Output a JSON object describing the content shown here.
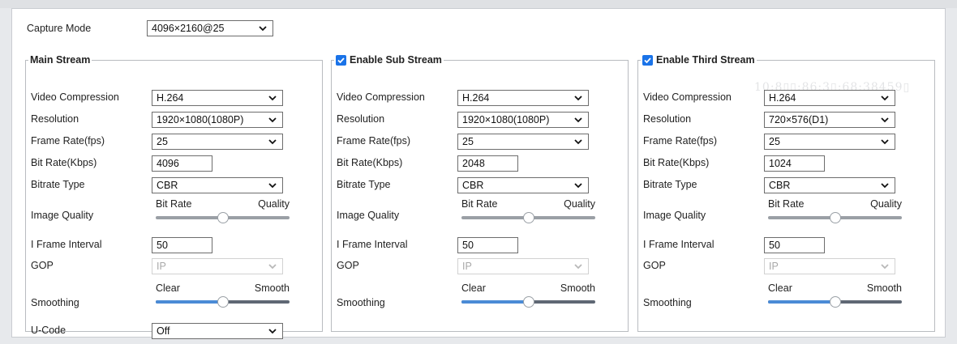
{
  "capture": {
    "label": "Capture Mode",
    "value": "4096×2160@25"
  },
  "watermark": "10:8▯▯:86:3▯:68:38459▯",
  "streams": [
    {
      "title": "Main Stream",
      "checkbox": false,
      "labels": {
        "compression": "Video Compression",
        "resolution": "Resolution",
        "framerate": "Frame Rate(fps)",
        "bitrate": "Bit Rate(Kbps)",
        "bitrate_type": "Bitrate Type",
        "image_quality": "Image Quality",
        "iframe": "I Frame Interval",
        "gop": "GOP",
        "smoothing": "Smoothing",
        "ucode": "U-Code"
      },
      "compression": "H.264",
      "resolution": "1920×1080(1080P)",
      "framerate": "25",
      "bitrate": "4096",
      "bitrate_type": "CBR",
      "quality_left": "Bit Rate",
      "quality_right": "Quality",
      "quality_level": 0.5,
      "iframe": "50",
      "gop": "IP",
      "smooth_left": "Clear",
      "smooth_right": "Smooth",
      "smooth_level": 0.5,
      "ucode": "Off"
    },
    {
      "title": "Enable Sub Stream",
      "checkbox": true,
      "labels": {
        "compression": "Video Compression",
        "resolution": "Resolution",
        "framerate": "Frame Rate(fps)",
        "bitrate": "Bit Rate(Kbps)",
        "bitrate_type": "Bitrate Type",
        "image_quality": "Image Quality",
        "iframe": "I Frame Interval",
        "gop": "GOP",
        "smoothing": "Smoothing"
      },
      "compression": "H.264",
      "resolution": "1920×1080(1080P)",
      "framerate": "25",
      "bitrate": "2048",
      "bitrate_type": "CBR",
      "quality_left": "Bit Rate",
      "quality_right": "Quality",
      "quality_level": 0.5,
      "iframe": "50",
      "gop": "IP",
      "smooth_left": "Clear",
      "smooth_right": "Smooth",
      "smooth_level": 0.5
    },
    {
      "title": "Enable Third Stream",
      "checkbox": true,
      "labels": {
        "compression": "Video Compression",
        "resolution": "Resolution",
        "framerate": "Frame Rate(fps)",
        "bitrate": "Bit Rate(Kbps)",
        "bitrate_type": "Bitrate Type",
        "image_quality": "Image Quality",
        "iframe": "I Frame Interval",
        "gop": "GOP",
        "smoothing": "Smoothing"
      },
      "compression": "H.264",
      "resolution": "720×576(D1)",
      "framerate": "25",
      "bitrate": "1024",
      "bitrate_type": "CBR",
      "quality_left": "Bit Rate",
      "quality_right": "Quality",
      "quality_level": 0.5,
      "iframe": "50",
      "gop": "IP",
      "smooth_left": "Clear",
      "smooth_right": "Smooth",
      "smooth_level": 0.5
    }
  ],
  "colors": {
    "checkbox": "#1a73e8",
    "slider_fill": "#4b8bd6"
  }
}
